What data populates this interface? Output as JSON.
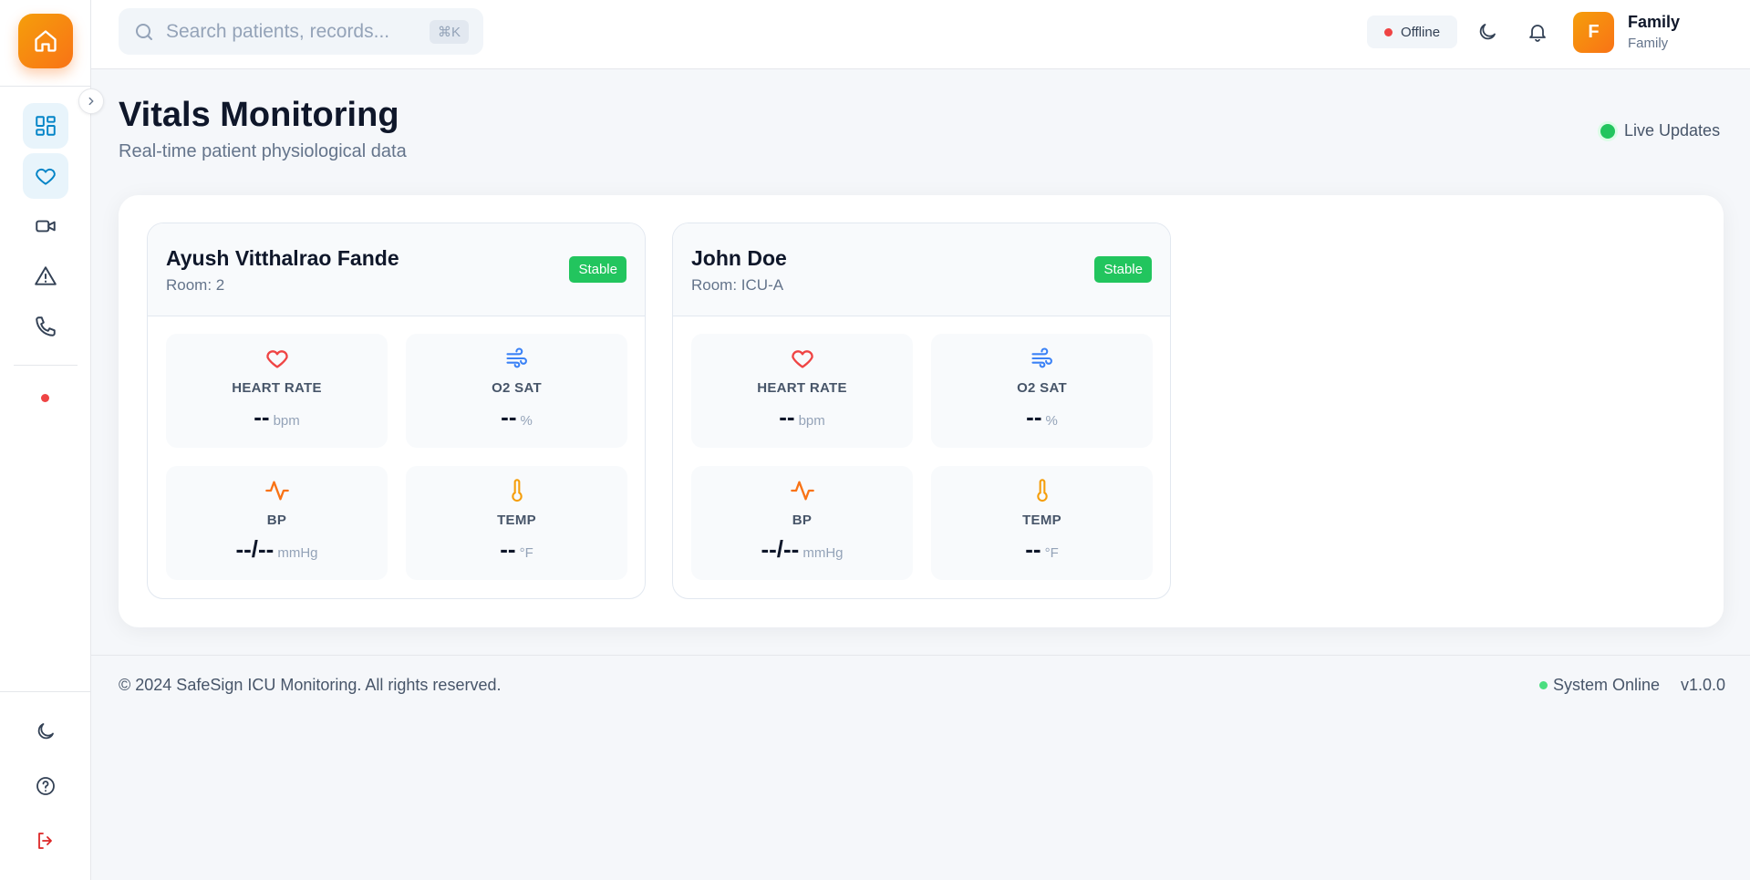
{
  "sidebar": {
    "home_icon": "home-icon",
    "collapse_icon": "chevron-right-icon",
    "nav": [
      {
        "icon": "dashboard-icon",
        "active": true
      },
      {
        "icon": "heart-icon",
        "active": true
      },
      {
        "icon": "video-icon",
        "active": false
      },
      {
        "icon": "alert-triangle-icon",
        "active": false
      },
      {
        "icon": "phone-icon",
        "active": false
      }
    ],
    "bottom": [
      "moon-icon",
      "help-icon",
      "logout-icon"
    ]
  },
  "header": {
    "search_placeholder": "Search patients, records...",
    "shortcut": "⌘K",
    "connection_status": "Offline",
    "user": {
      "initial": "F",
      "name": "Family",
      "role": "Family"
    }
  },
  "page": {
    "title": "Vitals Monitoring",
    "subtitle": "Real-time patient physiological data",
    "live_label": "Live Updates"
  },
  "patients": [
    {
      "name": "Ayush Vitthalrao Fande",
      "room": "Room: 2",
      "status": "Stable",
      "vitals": {
        "heart_rate": {
          "label": "HEART RATE",
          "value": "--",
          "unit": "bpm"
        },
        "o2_sat": {
          "label": "O2 SAT",
          "value": "--",
          "unit": "%"
        },
        "bp": {
          "label": "BP",
          "value": "--/--",
          "unit": "mmHg"
        },
        "temp": {
          "label": "TEMP",
          "value": "--",
          "unit": "°F"
        }
      }
    },
    {
      "name": "John Doe",
      "room": "Room: ICU-A",
      "status": "Stable",
      "vitals": {
        "heart_rate": {
          "label": "HEART RATE",
          "value": "--",
          "unit": "bpm"
        },
        "o2_sat": {
          "label": "O2 SAT",
          "value": "--",
          "unit": "%"
        },
        "bp": {
          "label": "BP",
          "value": "--/--",
          "unit": "mmHg"
        },
        "temp": {
          "label": "TEMP",
          "value": "--",
          "unit": "°F"
        }
      }
    }
  ],
  "footer": {
    "copyright": "© 2024 SafeSign ICU Monitoring. All rights reserved.",
    "system_status": "System Online",
    "version": "v1.0.0"
  },
  "colors": {
    "accent_orange": "#f97316",
    "accent_blue": "#0284c7",
    "stable_green": "#22c55e",
    "offline_red": "#ef4444"
  }
}
